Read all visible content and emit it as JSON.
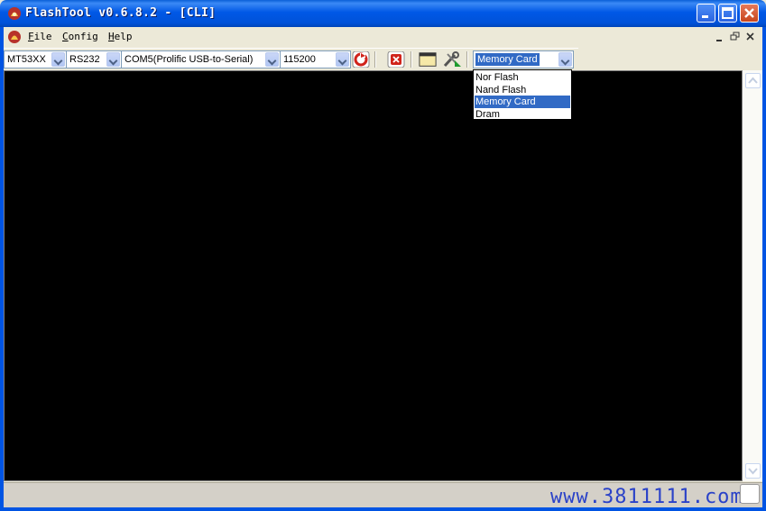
{
  "window": {
    "title": "FlashTool v0.6.8.2 - [CLI]"
  },
  "menu": {
    "items": [
      {
        "label": "File",
        "mnemonic": "F",
        "rest": "ile"
      },
      {
        "label": "Config",
        "mnemonic": "C",
        "rest": "onfig"
      },
      {
        "label": "Help",
        "mnemonic": "H",
        "rest": "elp"
      }
    ]
  },
  "toolbar": {
    "chip": "MT53XX",
    "interface": "RS232",
    "port": "COM5(Prolific USB-to-Serial)",
    "baud": "115200",
    "storage": "Memory Card"
  },
  "storage_dropdown": {
    "options": [
      "Nor Flash",
      "Nand Flash",
      "Memory Card",
      "Dram"
    ],
    "highlighted": "Memory Card"
  },
  "statusbar": {
    "watermark": "www.3811111.com"
  },
  "icons": {
    "app": "flame-app-icon",
    "connect": "refresh-icon",
    "stop": "stop-icon",
    "window_view": "window-icon",
    "tools": "tools-icon"
  },
  "colors": {
    "titlebar": "#0054e3",
    "selection": "#316ac5",
    "console_bg": "#000000",
    "close_button": "#d5522a"
  }
}
